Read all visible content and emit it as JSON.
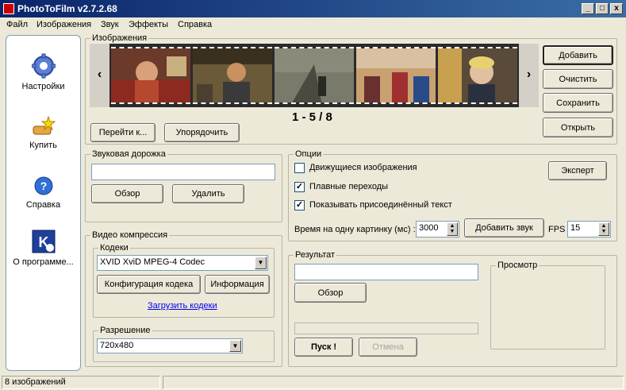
{
  "window": {
    "title": "PhotoToFilm v2.7.2.68",
    "controls": [
      "_",
      "□",
      "x"
    ]
  },
  "menu": [
    "Файл",
    "Изображения",
    "Звук",
    "Эффекты",
    "Справка"
  ],
  "sidebar": {
    "items": [
      {
        "label": "Настройки",
        "icon": "gear-icon"
      },
      {
        "label": "Купить",
        "icon": "buy-icon"
      },
      {
        "label": "Справка",
        "icon": "help-icon"
      },
      {
        "label": "О программе...",
        "icon": "about-icon"
      }
    ]
  },
  "images": {
    "group_title": "Изображения",
    "counter": "1 - 5 / 8",
    "prev": "‹",
    "next": "›",
    "goto_label": "Перейти к...",
    "sort_label": "Упорядочить",
    "add_label": "Добавить",
    "clear_label": "Очистить",
    "save_label": "Сохранить",
    "open_label": "Открыть"
  },
  "audio": {
    "group_title": "Звуковая дорожка",
    "path_value": "",
    "browse_label": "Обзор",
    "delete_label": "Удалить"
  },
  "video": {
    "group_title": "Видео компрессия",
    "codecs_title": "Кодеки",
    "codec_value": "XVID XviD MPEG-4 Codec",
    "config_label": "Конфигурация кодека",
    "info_label": "Информация",
    "download_link": "Загрузить кодеки",
    "resolution_title": "Разрешение",
    "resolution_value": "720x480"
  },
  "options": {
    "group_title": "Опции",
    "moving_images": "Движущиеся изображения",
    "moving_checked": "",
    "smooth_transitions": "Плавные переходы",
    "smooth_checked": "✓",
    "show_text": "Показывать присоединённый текст",
    "text_checked": "✓",
    "expert_label": "Эксперт",
    "time_label": "Время на одну картинку (мс) :",
    "time_value": "3000",
    "add_sound_label": "Добавить звук",
    "fps_label": "FPS",
    "fps_value": "15"
  },
  "result": {
    "group_title": "Результат",
    "path_value": "",
    "browse_label": "Обзор",
    "preview_title": "Просмотр",
    "start_label": "Пуск !",
    "cancel_label": "Отмена",
    "progress": 0
  },
  "status": {
    "text": "8 изображений"
  },
  "colors": {
    "title_bar": "#0a246a",
    "face": "#ece9d8",
    "link": "#0000ee"
  }
}
